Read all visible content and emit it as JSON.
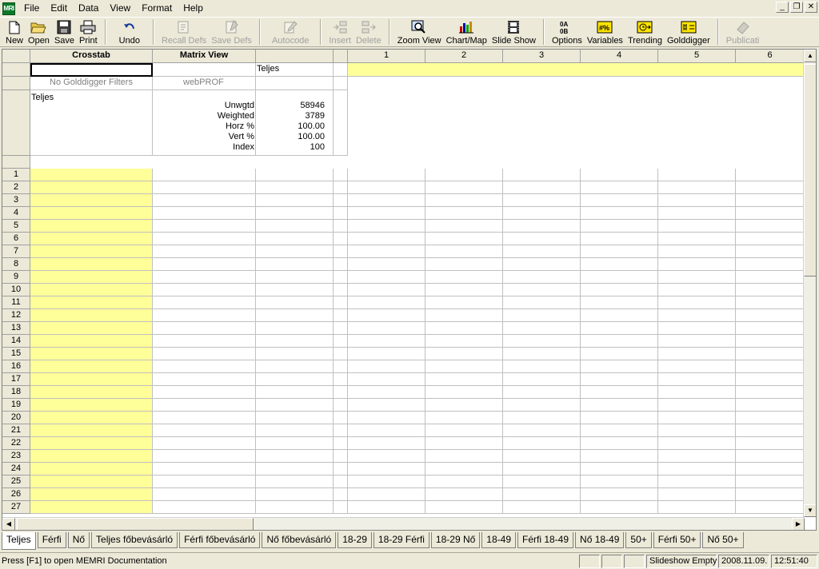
{
  "app": {
    "icon_text": "MRI"
  },
  "menu": [
    "File",
    "Edit",
    "Data",
    "View",
    "Format",
    "Help"
  ],
  "toolbar": {
    "new": "New",
    "open": "Open",
    "save": "Save",
    "print": "Print",
    "undo": "Undo",
    "recall_defs": "Recall Defs",
    "save_defs": "Save Defs",
    "autocode": "Autocode",
    "insert": "Insert",
    "delete": "Delete",
    "zoom_view": "Zoom View",
    "chart_map": "Chart/Map",
    "slide_show": "Slide Show",
    "options": "Options",
    "variables": "Variables",
    "trending": "Trending",
    "golddigger": "Golddigger",
    "publication": "Publicati"
  },
  "grid": {
    "col_header_crosstab": "Crosstab",
    "col_header_matrix": "Matrix View",
    "col_numbers": [
      "1",
      "2",
      "3",
      "4",
      "5",
      "6"
    ],
    "teljes_header": "Teljes",
    "filter_text": "No Golddigger Filters",
    "webprof": "webPROF",
    "base_label": "Teljes",
    "stats_labels": [
      "Unwgtd",
      "Weighted",
      "Horz %",
      "Vert %",
      "Index"
    ],
    "stats_values": [
      "58946",
      "3789",
      "100.00",
      "100.00",
      "100"
    ],
    "row_numbers": [
      "1",
      "2",
      "3",
      "4",
      "5",
      "6",
      "7",
      "8",
      "9",
      "10",
      "11",
      "12",
      "13",
      "14",
      "15",
      "16",
      "17",
      "18",
      "19",
      "20",
      "21",
      "22",
      "23",
      "24",
      "25",
      "26",
      "27"
    ]
  },
  "tabs": [
    "Teljes",
    "Férfi",
    "Nő",
    "Teljes főbevásárló",
    "Férfi főbevásárló",
    "Nő főbevásárló",
    "18-29",
    "18-29 Férfi",
    "18-29 Nő",
    "18-49",
    "Férfi 18-49",
    "Nő 18-49",
    "50+",
    "Férfi 50+",
    "Nő 50+"
  ],
  "status": {
    "message": "Press [F1] to open MEMRI Documentation",
    "slideshow": "Slideshow Empty",
    "date": "2008.11.09.",
    "time": "12:51:40"
  },
  "colors": {
    "yellow": "#ffff99",
    "chrome": "#ece9d8"
  }
}
